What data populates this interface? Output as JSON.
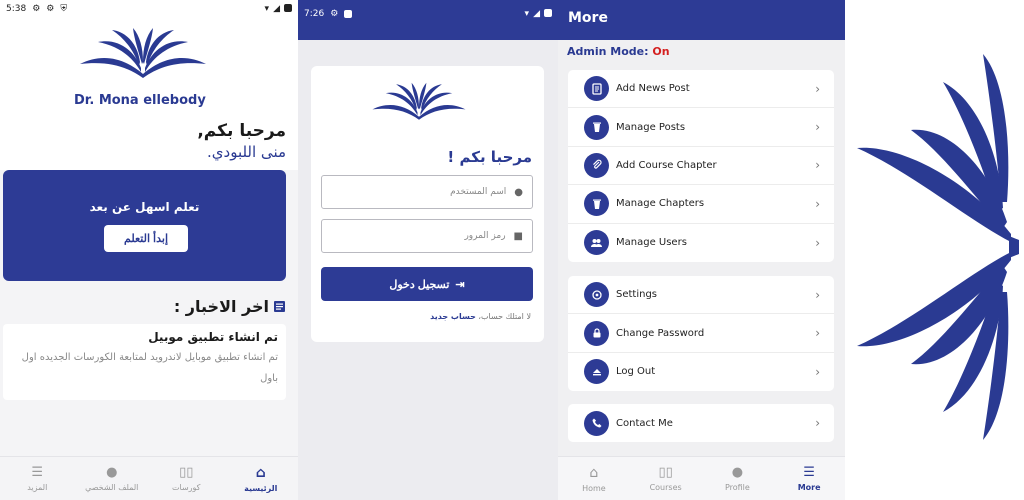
{
  "screen_home": {
    "status_time": "5:38",
    "brand": "Dr. Mona ellebody",
    "welcome_line1": "مرحبا بكم,",
    "welcome_line2": "منى اللبودي.",
    "hero_text": "تعلم اسهل عن بعد",
    "hero_button": "إبدأ التعلم",
    "news_heading": "اخر الاخبار :",
    "news_item_title": "تم انشاء تطبيق موبيل",
    "news_item_body": "تم انشاء تطبيق موبايل لاندرويد لمتابعة الكورسات الجديده اول باول",
    "nav": [
      {
        "label": "الرئيسية",
        "icon": "home-icon"
      },
      {
        "label": "كورسات",
        "icon": "book-icon"
      },
      {
        "label": "الملف الشخصي",
        "icon": "person-icon"
      },
      {
        "label": "المزيد",
        "icon": "list-icon"
      }
    ]
  },
  "screen_login": {
    "status_time": "7:26",
    "greeting": "مرحبا بكم !",
    "username_placeholder": "اسم المستخدم",
    "password_placeholder": "رمز المرور",
    "login_button": "تسجيل دخول",
    "register_prompt": "لا امتلك حساب،",
    "register_link": "حساب جديد"
  },
  "screen_more": {
    "title": "More",
    "admin_label": "Admin Mode:",
    "admin_value": "On",
    "admin_color": "#d42020",
    "group1": [
      {
        "label": "Add News Post",
        "icon": "news-icon"
      },
      {
        "label": "Manage Posts",
        "icon": "trash-icon"
      },
      {
        "label": "Add Course Chapter",
        "icon": "paperclip-icon"
      },
      {
        "label": "Manage Chapters",
        "icon": "trash-icon"
      },
      {
        "label": "Manage Users",
        "icon": "users-icon"
      }
    ],
    "group2": [
      {
        "label": "Settings",
        "icon": "settings-icon"
      },
      {
        "label": "Change Password",
        "icon": "lock-icon"
      },
      {
        "label": "Log Out",
        "icon": "logout-icon"
      }
    ],
    "group3": [
      {
        "label": "Contact Me",
        "icon": "phone-icon"
      }
    ],
    "nav": [
      {
        "label": "Home",
        "icon": "home-icon"
      },
      {
        "label": "Courses",
        "icon": "book-icon"
      },
      {
        "label": "Profile",
        "icon": "person-icon"
      },
      {
        "label": "More",
        "icon": "list-icon"
      }
    ]
  },
  "colors": {
    "brand_blue": "#2d3b95",
    "accent_red": "#d42020"
  }
}
